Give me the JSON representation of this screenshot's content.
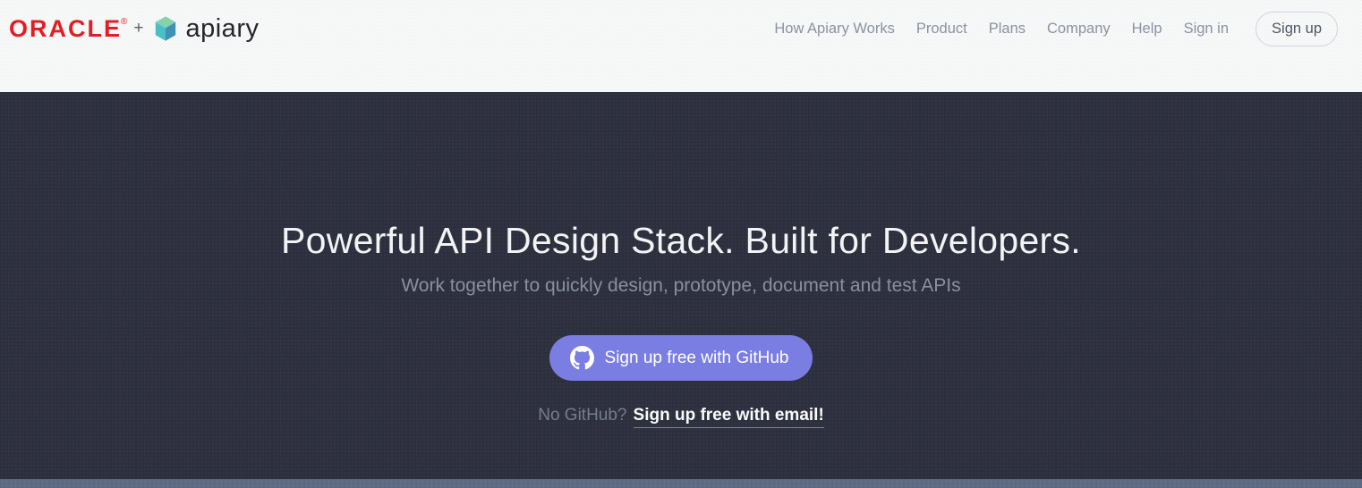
{
  "header": {
    "logo": {
      "oracle": "ORACLE",
      "registered_mark": "®",
      "plus": "+",
      "apiary": "apiary"
    },
    "nav_items": [
      "How Apiary Works",
      "Product",
      "Plans",
      "Company",
      "Help",
      "Sign in"
    ],
    "signup_label": "Sign up"
  },
  "hero": {
    "title": "Powerful API Design Stack. Built for Developers.",
    "subtitle": "Work together to quickly design, prototype, document and test APIs",
    "github_button_label": "Sign up free with GitHub",
    "no_github_text": "No GitHub?",
    "email_link_label": "Sign up free with email!"
  },
  "icons": {
    "github": "github-octocat-icon",
    "apiary_mark": "apiary-cube-icon"
  },
  "colors": {
    "header_bg": "#f6f7f7",
    "hero_bg": "#2c303e",
    "accent_purple": "#7a7ee2",
    "oracle_red": "#e21e25",
    "nav_text": "#8a93a2",
    "footer_strip": "#5d6983",
    "apiary_green": "#85d3ab",
    "apiary_teal": "#4bbec6",
    "apiary_blue": "#3f92b5"
  }
}
